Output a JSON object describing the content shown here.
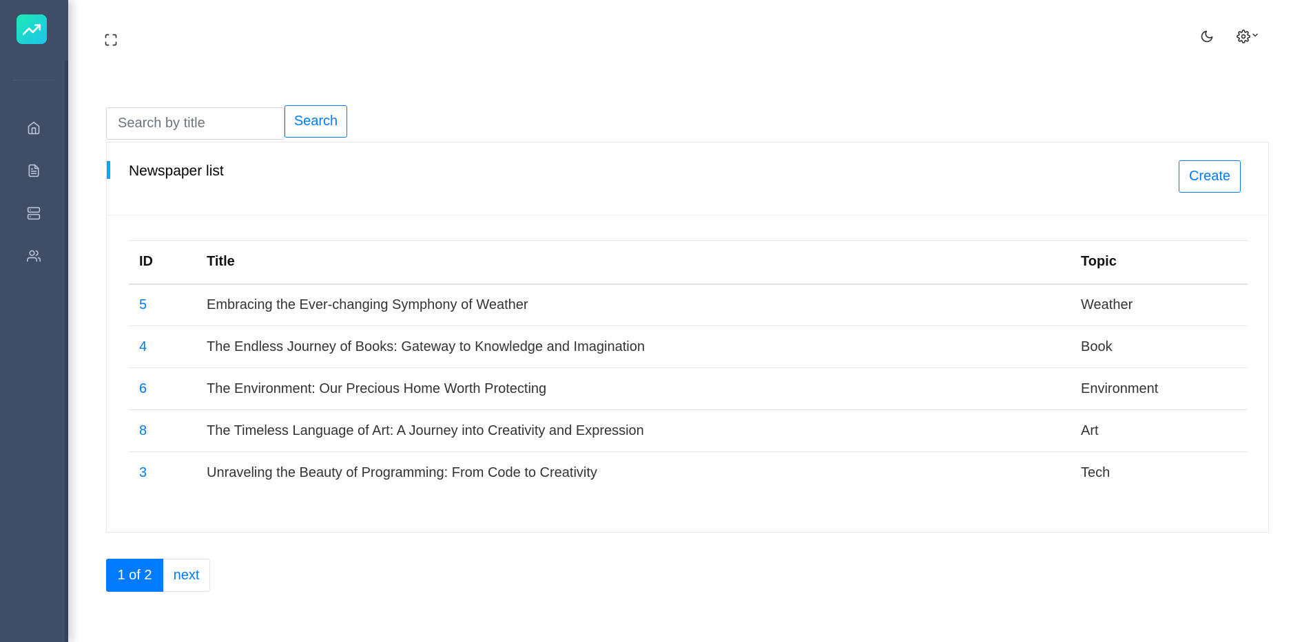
{
  "sidebar": {
    "logo_icon": "trending-up-icon",
    "items": [
      {
        "icon": "home-icon"
      },
      {
        "icon": "file-text-icon"
      },
      {
        "icon": "server-icon"
      },
      {
        "icon": "users-icon"
      }
    ]
  },
  "header": {
    "fullscreen_icon": "maximize-icon",
    "theme_icon": "moon-icon",
    "settings_icon": "gear-icon"
  },
  "search": {
    "placeholder": "Search by title",
    "button_label": "Search"
  },
  "card": {
    "title": "Newspaper list",
    "create_label": "Create",
    "columns": [
      "ID",
      "Title",
      "Topic"
    ],
    "rows": [
      {
        "id": "5",
        "title": "Embracing the Ever-changing Symphony of Weather",
        "topic": "Weather"
      },
      {
        "id": "4",
        "title": "The Endless Journey of Books: Gateway to Knowledge and Imagination",
        "topic": "Book"
      },
      {
        "id": "6",
        "title": "The Environment: Our Precious Home Worth Protecting",
        "topic": "Environment"
      },
      {
        "id": "8",
        "title": "The Timeless Language of Art: A Journey into Creativity and Expression",
        "topic": "Art"
      },
      {
        "id": "3",
        "title": "Unraveling the Beauty of Programming: From Code to Creativity",
        "topic": "Tech"
      }
    ]
  },
  "pagination": {
    "current": "1 of 2",
    "next": "next"
  },
  "colors": {
    "sidebar_bg": "#3f4d67",
    "primary": "#007bff",
    "accent": "#04a9f5",
    "logo_gradient_start": "#1de9b6",
    "logo_gradient_end": "#1dc4e9"
  }
}
